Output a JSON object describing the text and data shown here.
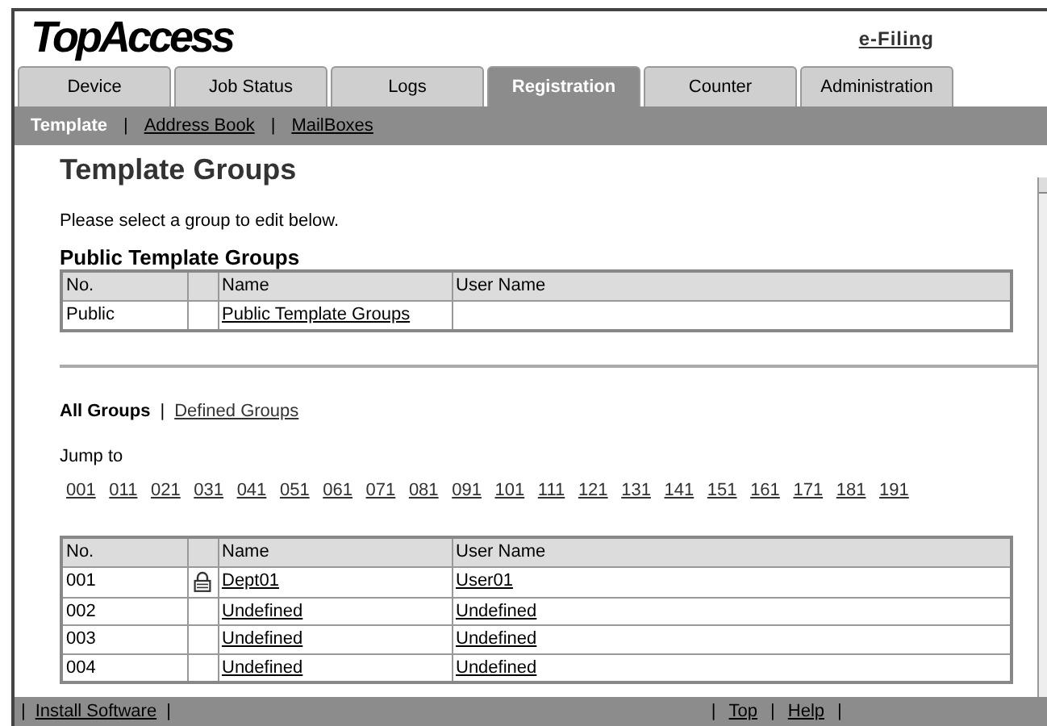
{
  "logo": "TopAccess",
  "top_link": "e-Filing",
  "tabs": [
    {
      "label": "Device",
      "selected": false
    },
    {
      "label": "Job Status",
      "selected": false
    },
    {
      "label": "Logs",
      "selected": false
    },
    {
      "label": "Registration",
      "selected": true
    },
    {
      "label": "Counter",
      "selected": false
    },
    {
      "label": "Administration",
      "selected": false
    }
  ],
  "subnav": {
    "separator": "|",
    "items": [
      {
        "label": "Template",
        "selected": true
      },
      {
        "label": "Address Book",
        "selected": false
      },
      {
        "label": "MailBoxes",
        "selected": false
      }
    ]
  },
  "page_title": "Template Groups",
  "instruction": "Please select a group to edit below.",
  "public_groups": {
    "title": "Public Template Groups",
    "columns": [
      "No.",
      "Name",
      "User Name"
    ],
    "rows": [
      {
        "no": "Public",
        "locked": false,
        "name": "Public Template Groups"
      }
    ]
  },
  "group_filter": {
    "separator": "|",
    "items": [
      {
        "label": "All Groups",
        "selected": true
      },
      {
        "label": "Defined Groups",
        "selected": false
      }
    ]
  },
  "jump_label": "Jump to",
  "jump_links": [
    "001",
    "011",
    "021",
    "031",
    "041",
    "051",
    "061",
    "071",
    "081",
    "091",
    "101",
    "111",
    "121",
    "131",
    "141",
    "151",
    "161",
    "171",
    "181",
    "191"
  ],
  "groups_table": {
    "columns": [
      "No.",
      "Name",
      "User Name"
    ],
    "rows": [
      {
        "no": "001",
        "locked": true,
        "name": "Dept01",
        "user_name": "User01"
      },
      {
        "no": "002",
        "locked": false,
        "name": "Undefined",
        "user_name": "Undefined"
      },
      {
        "no": "003",
        "locked": false,
        "name": "Undefined",
        "user_name": "Undefined"
      },
      {
        "no": "004",
        "locked": false,
        "name": "Undefined",
        "user_name": "Undefined"
      }
    ]
  },
  "footer": {
    "separator": "|",
    "left": [
      "Install Software"
    ],
    "right": [
      "Top",
      "Help"
    ]
  }
}
